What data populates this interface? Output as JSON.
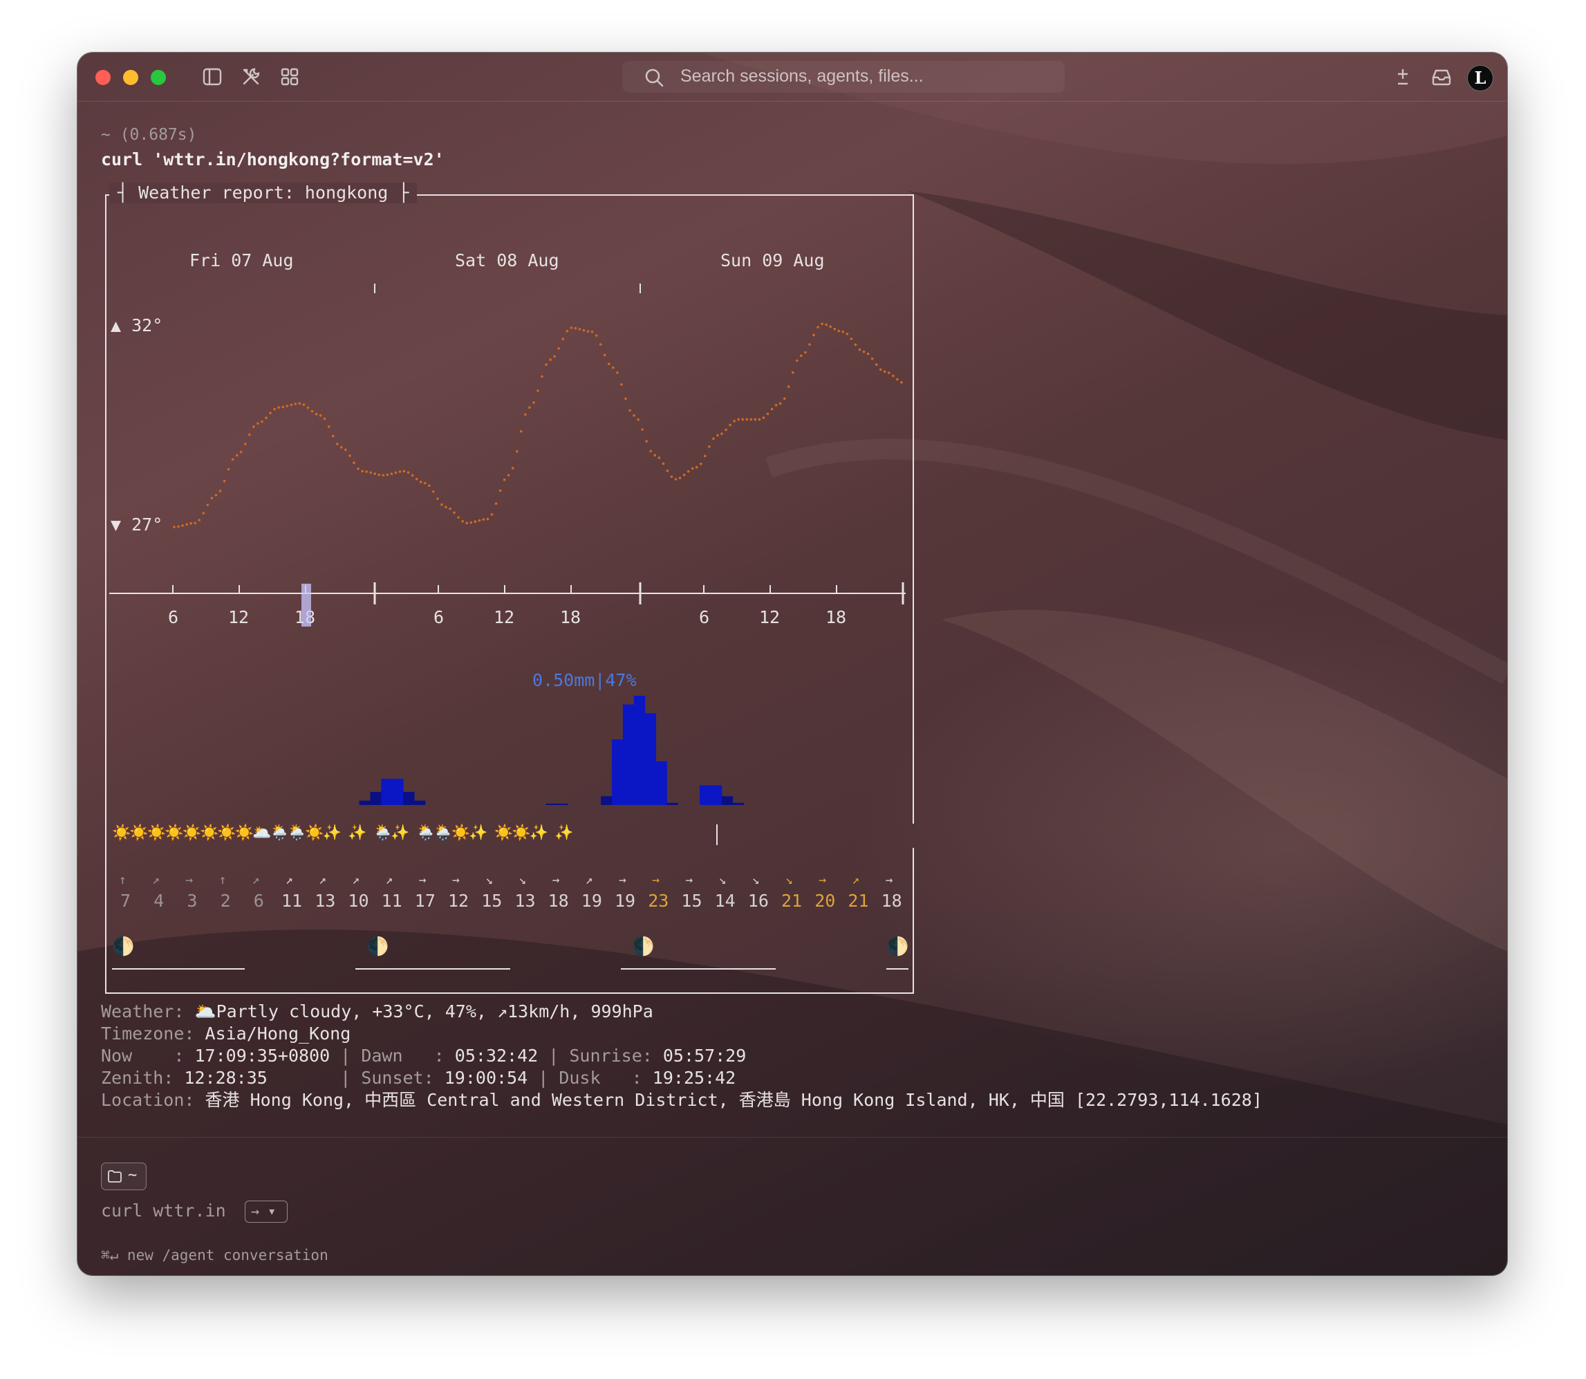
{
  "titlebar": {
    "search_placeholder": "Search sessions, agents, files...",
    "avatar_letter": "L",
    "icons": [
      "sidebar-toggle-icon",
      "tools-icon",
      "grid-icon",
      "search-icon",
      "plus-minus-icon",
      "inbox-icon"
    ]
  },
  "block": {
    "meta": "~ (0.687s)",
    "command": "curl 'wttr.in/hongkong?format=v2'"
  },
  "report": {
    "title": "Weather report: hongkong",
    "days": [
      "Fri 07 Aug",
      "Sat 08 Aug",
      "Sun 09 Aug"
    ],
    "temp_high_label": "▲ 32°",
    "temp_low_label": "▼ 27°",
    "hour_ticks": [
      "6",
      "12",
      "18",
      "6",
      "12",
      "18",
      "6",
      "12",
      "18"
    ],
    "precip_label": "0.50mm|47%",
    "weather_icons": "☀️☀️☀️☀️☀️☀️☀️☀️🌥️🌦️🌦️☀️✨ ✨ 🌦️✨ 🌦️🌦️☀️✨ ☀️☀️✨ ✨",
    "wind_arrows": [
      "↑",
      "↗",
      "→",
      "↑",
      "↗",
      "↗",
      "↗",
      "↗",
      "↗",
      "→",
      "→",
      "↘",
      "↘",
      "→",
      "↗",
      "→",
      "→",
      "→",
      "↘",
      "↘",
      "↘",
      "→",
      "↗",
      "→"
    ],
    "wind_speeds": [
      "7",
      "4",
      "3",
      "2",
      "6",
      "11",
      "13",
      "10",
      "11",
      "17",
      "12",
      "15",
      "13",
      "18",
      "19",
      "19",
      "23",
      "15",
      "14",
      "16",
      "21",
      "20",
      "21",
      "18"
    ],
    "moon_icons": [
      "🌓",
      "🌓",
      "🌓",
      "🌓"
    ]
  },
  "chart_data": [
    {
      "type": "line",
      "title": "",
      "xlabel": "",
      "ylabel": "",
      "series": [
        {
          "values": [
            27.0,
            27.1,
            27.8,
            28.8,
            29.6,
            30.0,
            30.1,
            29.8,
            29.0,
            28.4,
            28.3,
            28.4,
            28.1,
            27.5,
            27.1,
            27.2,
            28.3,
            30.0,
            31.2,
            32.0,
            31.9,
            31.0,
            29.8,
            28.8,
            28.2,
            28.5,
            29.3,
            29.7,
            29.7,
            30.1,
            31.3,
            32.1,
            31.9,
            31.4,
            30.9,
            30.6
          ],
          "color": "#d06a22"
        }
      ],
      "ylim": [
        27,
        32
      ],
      "y_tick_labels": [
        "▲ 32°",
        "▼ 27°"
      ],
      "x_tick_labels": [
        "6",
        "12",
        "18",
        "6",
        "12",
        "18",
        "6",
        "12",
        "18"
      ],
      "x_group_labels": [
        "Fri 07 Aug",
        "Sat 08 Aug",
        "Sun 09 Aug"
      ]
    },
    {
      "type": "bar",
      "title": "",
      "annotation": "0.50mm|47%",
      "values": [
        0,
        0,
        0,
        0,
        0,
        0,
        0,
        0,
        0,
        0,
        0,
        0,
        0,
        0,
        0,
        0,
        0,
        0,
        0,
        0,
        0,
        0.02,
        0.06,
        0.12,
        0.12,
        0.06,
        0.02,
        0,
        0,
        0,
        0,
        0,
        0,
        0,
        0,
        0,
        0,
        0,
        0.005,
        0.005,
        0,
        0,
        0,
        0.04,
        0.3,
        0.46,
        0.5,
        0.42,
        0.2,
        0.01,
        0,
        0,
        0.09,
        0.09,
        0.04,
        0.01,
        0,
        0,
        0,
        0,
        0,
        0,
        0,
        0,
        0,
        0,
        0,
        0,
        0,
        0
      ],
      "color": "#0b17c4"
    }
  ],
  "summary": {
    "weather_label": "Weather:",
    "weather_value": "🌥️Partly cloudy, +33°C, 47%, ↗13km/h, 999hPa",
    "timezone_label": "Timezone:",
    "timezone_value": "Asia/Hong_Kong",
    "now_label": "Now    :",
    "now_value": "17:09:35+0800",
    "dawn_label": "| Dawn   :",
    "dawn_value": "05:32:42",
    "sunrise_label": "| Sunrise:",
    "sunrise_value": "05:57:29",
    "zenith_label": "Zenith:",
    "zenith_value": "12:28:35",
    "sunset_label": "| Sunset:",
    "sunset_value": "19:00:54",
    "dusk_label": "| Dusk   :",
    "dusk_value": "19:25:42",
    "location_label": "Location:",
    "location_value": "香港 Hong Kong, 中西區 Central and Western District, 香港島 Hong Kong Island, HK, 中国 [22.2793,114.1628]"
  },
  "footer": {
    "dir_chip": "~",
    "input_text": "curl wttr.in",
    "hint": "⌘↵ new /agent conversation"
  },
  "colors": {
    "temp_line": "#d06a22",
    "precip_bar": "#0b17c4",
    "precip_bar_dark": "#0b0f86",
    "precip_label": "#4a78e0",
    "wind_strong": "#e0a23a",
    "wind_weak": "#9c9494"
  }
}
